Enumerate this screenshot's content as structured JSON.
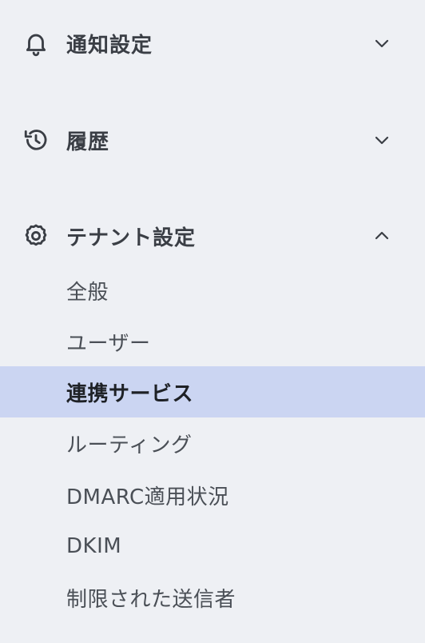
{
  "colors": {
    "background": "#eef0f4",
    "active_background": "#cbd5f2",
    "text": "#4a4f56",
    "active_text": "#1e2126"
  },
  "sections": [
    {
      "label": "通知設定",
      "icon": "bell-icon",
      "expanded": false
    },
    {
      "label": "履歴",
      "icon": "history-icon",
      "expanded": false
    },
    {
      "label": "テナント設定",
      "icon": "gear-icon",
      "expanded": true
    }
  ],
  "tenant_items": [
    {
      "label": "全般"
    },
    {
      "label": "ユーザー"
    },
    {
      "label": "連携サービス",
      "active": true
    },
    {
      "label": "ルーティング"
    },
    {
      "label": "DMARC適用状況"
    },
    {
      "label": "DKIM"
    },
    {
      "label": "制限された送信者"
    }
  ]
}
